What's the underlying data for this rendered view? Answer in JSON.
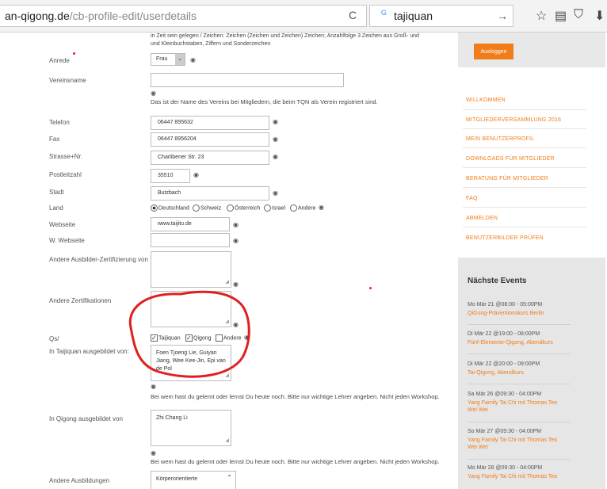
{
  "browser": {
    "url_host": "an-qigong.de",
    "url_path": "/cb-profile-edit/userdetails",
    "search_text": "tajiquan",
    "reload_glyph": "C",
    "search_go_glyph": "→",
    "icons": {
      "star": "☆",
      "reader": "▤",
      "pocket": "⛉",
      "download": "⬇"
    }
  },
  "form": {
    "intro_line1": "in Zeit sein gelegen / Zeichen: Zeichen (Zeichen und Zeichen) Zeichen; Anzahlfolge 3 Zeichen aus Groß- und",
    "intro_line2": "und Kleinbuchstaben, Ziffern und Sonderzeichen",
    "anrede_label": "Anrede",
    "anrede_value": "Frau",
    "vereinsname_label": "Vereinsname",
    "vereinsname_help": "Das ist der Name des Vereins bei Mitgliedern, die beim TQN als Verein registriert sind.",
    "telefon_label": "Telefon",
    "telefon_value": "06447 895632",
    "fax_label": "Fax",
    "fax_value": "06447 8956204",
    "strasse_label": "Strasse+Nr.",
    "strasse_value": "Charlibener Str. 23",
    "plz_label": "Postleitzahl",
    "plz_value": "35510",
    "stadt_label": "Stadt",
    "stadt_value": "Butzbach",
    "land_label": "Land",
    "land_options": [
      "Deutschland",
      "Schweiz",
      "Österreich",
      "Israel",
      "Andere"
    ],
    "webseite_label": "Webseite",
    "webseite_value": "www.taijitu.de",
    "w_webseite_label": "W. Webseite",
    "ausbilder_label": "Andere Ausbilder-Zertifizierung von",
    "zertifikationen_label": "Andere Zertifikationen",
    "qs_label": "Qs/",
    "qs_options": [
      "Taijiquan",
      "Qigong",
      "Andere"
    ],
    "taijiquan_label": "In Taijiquan ausgebildet von:",
    "taijiquan_value": "Foen Tjoeng Lie, Guiyan Jiang, Wee Kee-Jin, Epi van de Pol",
    "taijiquan_help": "Bei wem hast du gelernt oder lernst Du heute noch. Bitte nur wichtige Lehrer angeben. Nicht jeden Workshop.",
    "qigong_label": "In Qigong ausgebildet von",
    "qigong_value": "Zhi Chang Li",
    "qigong_help": "Bei wem hast du gelernt oder lernst Du heute noch. Bitte nur wichtige Lehrer angeben. Nicht jeden Workshop.",
    "andere_ausbildungen_label": "Andere Ausbildungen",
    "andere_ausbildungen_value": "Körperorientierte"
  },
  "sidebar": {
    "logout_label": "Ausloggen",
    "nav": [
      "WILLKOMMEN",
      "MITGLIEDERVERSAMMLUNG 2016",
      "MEIN BENUTZERPROFIL",
      "DOWNLOADS FÜR MITGLIEDER",
      "BERATUNG FÜR MITGLIEDER",
      "FAQ",
      "ABMELDEN",
      "BENUTZERBILDER PRÜFEN"
    ],
    "events_title": "Nächste Events",
    "events": [
      {
        "date": "Mo Mär 21 @08:00 - 05:00PM",
        "title": "QiGong-Präventionskurs Berlin"
      },
      {
        "date": "Di Mär 22 @19:00 - 08:00PM",
        "title": "Fünf-Elemente-Qigong, Abendkurs"
      },
      {
        "date": "Di Mär 22 @20:00 - 09:00PM",
        "title": "Tai-Qigong, Abendkurs"
      },
      {
        "date": "Sa Mär 26 @09:30 - 04:00PM",
        "title": "Yang Family Tai Chi mit Thomas Teo Wei Wei"
      },
      {
        "date": "So Mär 27 @09:30 - 04:00PM",
        "title": "Yang Family Tai Chi mit Thomas Teo Wei Wei"
      },
      {
        "date": "Mo Mär 28 @09:30 - 04:00PM",
        "title": "Yang Family Tai Chi mit Thomas Teo"
      }
    ]
  },
  "colors": {
    "accent": "#f07d1a",
    "annotation": "#e02020"
  }
}
